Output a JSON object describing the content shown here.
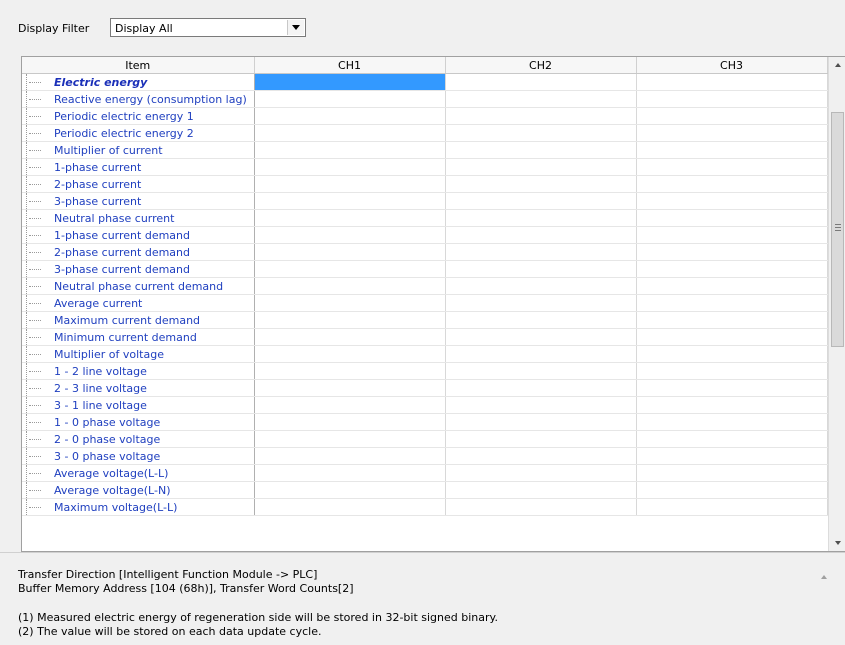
{
  "filter": {
    "label": "Display Filter",
    "selected": "Display All"
  },
  "grid": {
    "headers": [
      "Item",
      "CH1",
      "CH2",
      "CH3"
    ],
    "rows": [
      "Electric energy",
      "Reactive energy (consumption lag)",
      "Periodic electric energy 1",
      "Periodic electric energy 2",
      "Multiplier of current",
      "1-phase current",
      "2-phase current",
      "3-phase current",
      "Neutral phase current",
      "1-phase current demand",
      "2-phase current demand",
      "3-phase current demand",
      "Neutral phase current demand",
      "Average current",
      "Maximum current demand",
      "Minimum current demand",
      "Multiplier of voltage",
      "1 - 2 line voltage",
      "2 - 3 line voltage",
      "3 - 1 line voltage",
      "1 - 0 phase voltage",
      "2 - 0 phase voltage",
      "3 - 0 phase voltage",
      "Average voltage(L-L)",
      "Average voltage(L-N)",
      "Maximum voltage(L-L)"
    ],
    "selected_row": 0,
    "selected_color": "#3399ff",
    "item_color": "#1f3fbf"
  },
  "description": {
    "line1": "Transfer Direction [Intelligent Function Module -> PLC]",
    "line2": "Buffer Memory Address [104 (68h)], Transfer Word Counts[2]",
    "line3": "(1) Measured electric energy of regeneration side will be stored in 32-bit signed binary.",
    "line4": "(2) The value will be stored on each data update cycle."
  }
}
